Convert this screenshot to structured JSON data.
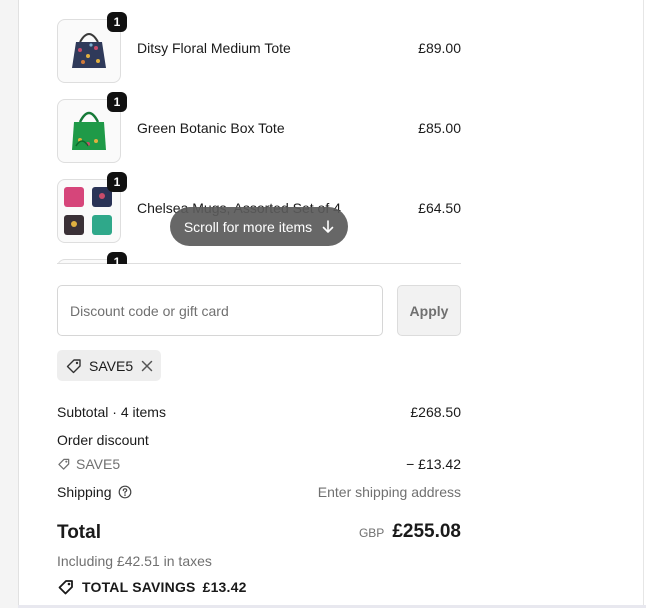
{
  "cart": {
    "items": [
      {
        "name": "Ditsy Floral Medium Tote",
        "price": "£89.00",
        "quantity": "1",
        "icon": "tote-bag-navy"
      },
      {
        "name": "Green Botanic Box Tote",
        "price": "£85.00",
        "quantity": "1",
        "icon": "tote-bag-green"
      },
      {
        "name": "Chelsea Mugs, Assorted Set of 4",
        "price": "£64.50",
        "quantity": "1",
        "icon": "mug-set"
      },
      {
        "name": "",
        "price": "",
        "quantity": "1",
        "icon": "product-thumb"
      }
    ],
    "scroll_hint": "Scroll for more items"
  },
  "discount": {
    "placeholder": "Discount code or gift card",
    "apply_label": "Apply",
    "applied_code": "SAVE5"
  },
  "summary": {
    "subtotal_label": "Subtotal · 4 items",
    "subtotal_value": "£268.50",
    "order_discount_label": "Order discount",
    "discount_code": "SAVE5",
    "discount_value": "− £13.42",
    "shipping_label": "Shipping",
    "shipping_value": "Enter shipping address",
    "total_label": "Total",
    "currency": "GBP",
    "total_value": "£255.08",
    "taxes_note": "Including £42.51 in taxes",
    "savings_label": "TOTAL SAVINGS",
    "savings_value": "£13.42"
  },
  "colors": {
    "text": "#1a1a1a",
    "muted": "#707070",
    "pill": "#5a5a5a",
    "tote_green": "#1f9a48",
    "tote_navy": "#2f3a5a"
  }
}
